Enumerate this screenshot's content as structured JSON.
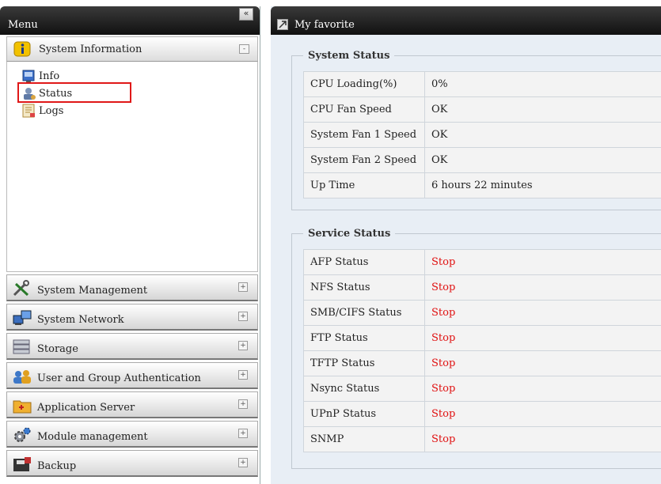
{
  "menu": {
    "title": "Menu",
    "collapse_label": "«",
    "system_information": {
      "label": "System Information",
      "toggle": "-",
      "items": [
        {
          "label": "Info",
          "icon": "info-icon"
        },
        {
          "label": "Status",
          "icon": "status-icon"
        },
        {
          "label": "Logs",
          "icon": "logs-icon"
        }
      ]
    },
    "sections": [
      {
        "label": "System Management",
        "icon": "tools-icon",
        "toggle": "+"
      },
      {
        "label": "System Network",
        "icon": "network-icon",
        "toggle": "+"
      },
      {
        "label": "Storage",
        "icon": "storage-icon",
        "toggle": "+"
      },
      {
        "label": "User and Group Authentication",
        "icon": "users-icon",
        "toggle": "+"
      },
      {
        "label": "Application Server",
        "icon": "folder-icon",
        "toggle": "+"
      },
      {
        "label": "Module management",
        "icon": "gears-icon",
        "toggle": "+"
      },
      {
        "label": "Backup",
        "icon": "backup-icon",
        "toggle": "+"
      }
    ]
  },
  "main": {
    "title": "My favorite",
    "system_status": {
      "legend": "System Status",
      "rows": [
        {
          "key": "CPU Loading(%)",
          "value": "0%"
        },
        {
          "key": "CPU Fan Speed",
          "value": "OK"
        },
        {
          "key": "System Fan 1 Speed",
          "value": "OK"
        },
        {
          "key": "System Fan 2 Speed",
          "value": "OK"
        },
        {
          "key": "Up Time",
          "value": "6 hours 22 minutes"
        }
      ]
    },
    "service_status": {
      "legend": "Service Status",
      "rows": [
        {
          "key": "AFP Status",
          "value": "Stop"
        },
        {
          "key": "NFS Status",
          "value": "Stop"
        },
        {
          "key": "SMB/CIFS Status",
          "value": "Stop"
        },
        {
          "key": "FTP Status",
          "value": "Stop"
        },
        {
          "key": "TFTP Status",
          "value": "Stop"
        },
        {
          "key": "Nsync Status",
          "value": "Stop"
        },
        {
          "key": "UPnP Status",
          "value": "Stop"
        },
        {
          "key": "SNMP",
          "value": "Stop"
        }
      ]
    }
  },
  "colors": {
    "header_bg": "#1a1a1a",
    "stop_text": "#e01010",
    "highlight_box": "#e01818",
    "content_bg": "#e8eef5"
  }
}
